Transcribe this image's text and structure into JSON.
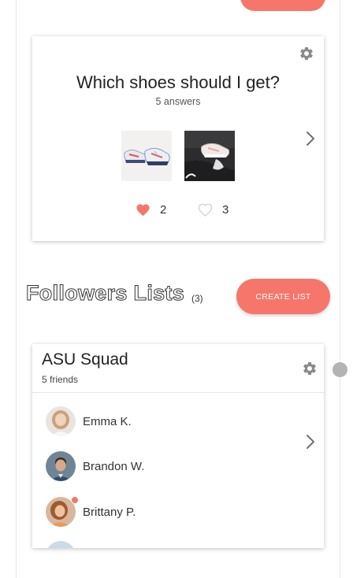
{
  "poll": {
    "question": "Which shoes should I get?",
    "answers_label": "5 answers",
    "options": [
      {
        "name": "option-1",
        "votes": "2",
        "liked": true
      },
      {
        "name": "option-2",
        "votes": "3",
        "liked": false
      }
    ]
  },
  "followers": {
    "title": "Followers Lists",
    "count": "(3)",
    "create_label": "CREATE LIST"
  },
  "list": {
    "name": "ASU Squad",
    "subtitle": "5 friends",
    "members": [
      {
        "name": "Emma K.",
        "online": false
      },
      {
        "name": "Brandon W.",
        "online": false
      },
      {
        "name": "Brittany P.",
        "online": true
      }
    ]
  },
  "colors": {
    "accent": "#f6766b",
    "icon_gray": "#8a8a8a"
  },
  "icons": [
    "gear-icon",
    "chevron-right-icon",
    "heart-filled-icon",
    "heart-outline-icon"
  ]
}
